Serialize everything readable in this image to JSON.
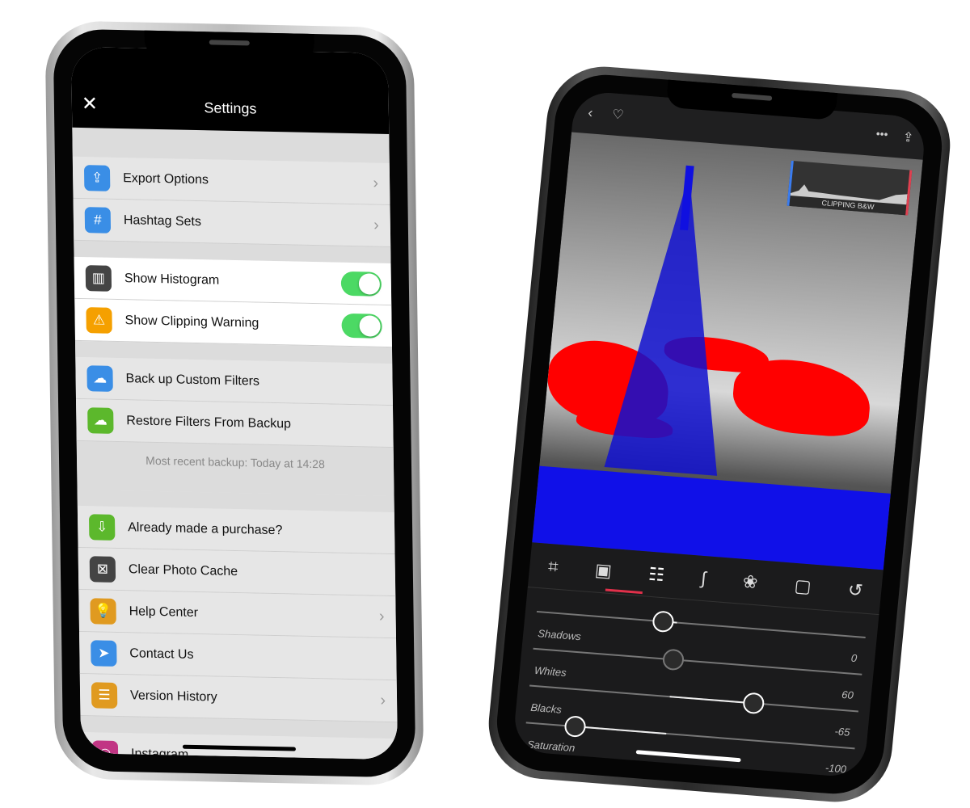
{
  "left_phone": {
    "header": {
      "title": "Settings",
      "close_icon": "close-icon"
    },
    "groups": [
      [
        {
          "label": "Export Options",
          "icon": "share-icon",
          "color": "#3a8ee6",
          "chevron": true
        },
        {
          "label": "Hashtag Sets",
          "icon": "hashtag-icon",
          "color": "#3a8ee6",
          "chevron": true
        }
      ],
      [
        {
          "label": "Show Histogram",
          "icon": "histogram-icon",
          "color": "#444444",
          "toggle": true
        },
        {
          "label": "Show Clipping Warning",
          "icon": "warning-icon",
          "color": "#f5a000",
          "toggle": true
        }
      ],
      [
        {
          "label": "Back up Custom Filters",
          "icon": "cloud-upload-icon",
          "color": "#3a8ee6"
        },
        {
          "label": "Restore Filters From Backup",
          "icon": "cloud-download-icon",
          "color": "#5cb82c"
        }
      ],
      [
        {
          "label": "Already made a purchase?",
          "icon": "cart-icon",
          "color": "#5cb82c"
        },
        {
          "label": "Clear Photo Cache",
          "icon": "cache-icon",
          "color": "#444444"
        },
        {
          "label": "Help Center",
          "icon": "lightbulb-icon",
          "color": "#e09a20",
          "chevron": true
        },
        {
          "label": "Contact Us",
          "icon": "send-icon",
          "color": "#3a8ee6"
        },
        {
          "label": "Version History",
          "icon": "list-icon",
          "color": "#e09a20",
          "chevron": true
        }
      ],
      [
        {
          "label": "Instagram",
          "icon": "instagram-icon",
          "color": "#c13584"
        }
      ]
    ],
    "backup_note": "Most recent backup: Today at 14:28"
  },
  "right_phone": {
    "histogram_caption": "CLIPPING B&W",
    "clip_colors": {
      "highlight": "#ff0000",
      "shadow": "#1010e8"
    },
    "tools": [
      "crop-icon",
      "frame-icon",
      "adjust-icon",
      "curves-icon",
      "color-mix-icon",
      "vignette-icon",
      "history-icon"
    ],
    "active_tool": "adjust-icon",
    "sliders": [
      {
        "name": "",
        "value": "",
        "level": -10
      },
      {
        "name": "Shadows",
        "value": "0",
        "level": 0
      },
      {
        "name": "Whites",
        "value": "60",
        "level": 60
      },
      {
        "name": "Blacks",
        "value": "-65",
        "level": -65
      },
      {
        "name": "Saturation",
        "value": "-100",
        "level": -100
      }
    ]
  }
}
